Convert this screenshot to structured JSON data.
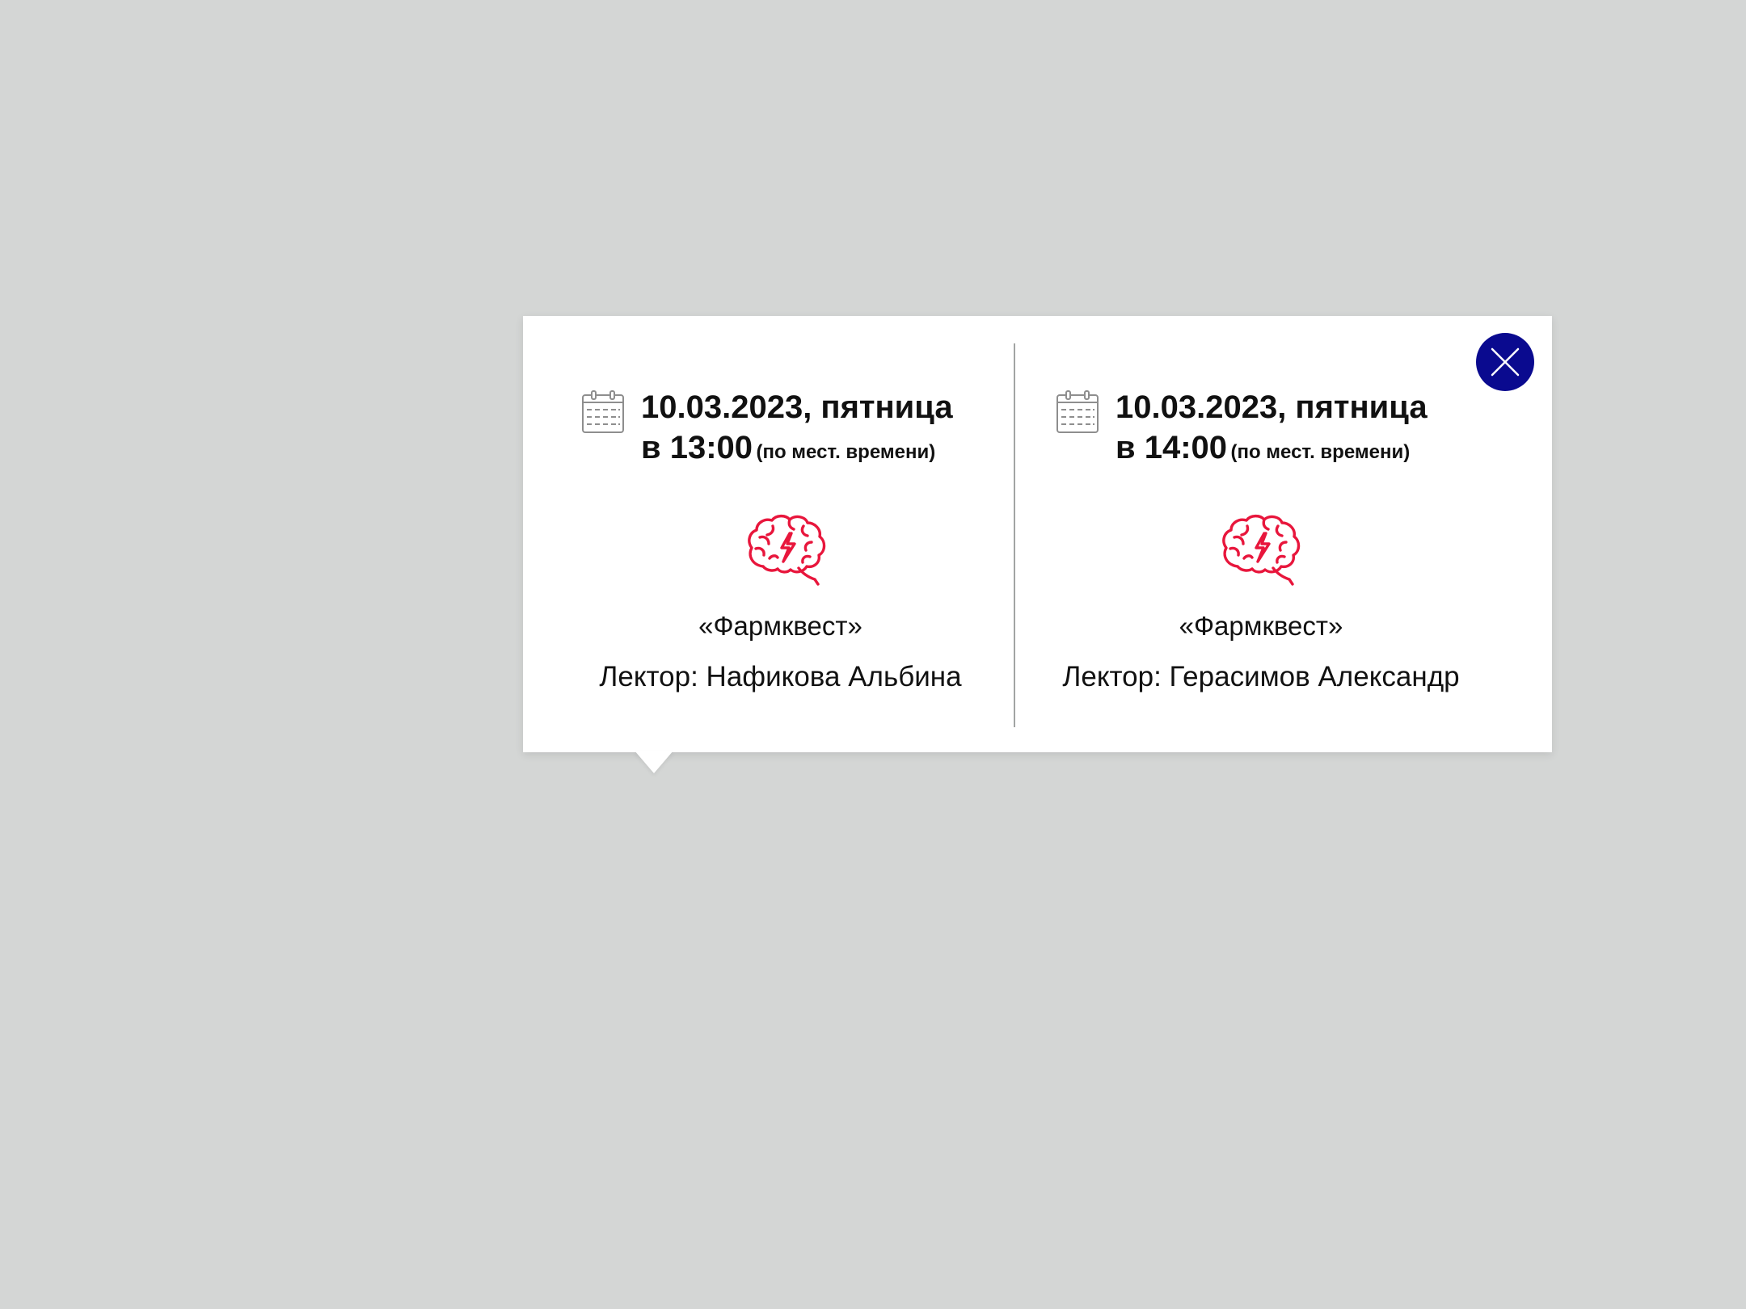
{
  "colors": {
    "background": "#d4d6d5",
    "popup": "#ffffff",
    "accent": "#0a0a8f",
    "icon_red": "#e8163c",
    "icon_gray": "#8e8e8e",
    "text": "#111111"
  },
  "close_button": {
    "icon": "close-icon"
  },
  "sessions": [
    {
      "icon": "calendar-icon",
      "date": "10.03.2023, пятница",
      "time": "в 13:00",
      "time_note": "(по мест. времени)",
      "topic_icon": "brain-lightning-icon",
      "title": "«Фармквест»",
      "lector": "Лектор: Нафикова Альбина"
    },
    {
      "icon": "calendar-icon",
      "date": "10.03.2023, пятница",
      "time": "в 14:00",
      "time_note": "(по мест. времени)",
      "topic_icon": "brain-lightning-icon",
      "title": "«Фармквест»",
      "lector": "Лектор: Герасимов Александр"
    }
  ]
}
